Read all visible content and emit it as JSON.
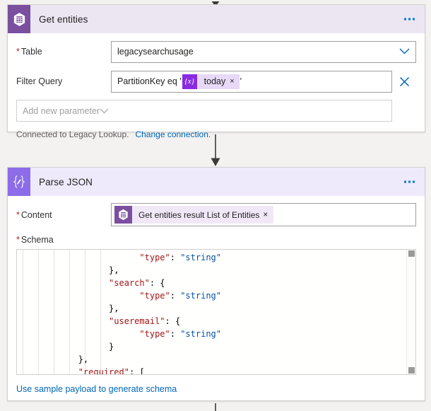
{
  "flow": {
    "connectors": [
      {
        "name": "connector-top",
        "type": "arrow-down-partial"
      },
      {
        "name": "connector-middle",
        "type": "arrow-down"
      },
      {
        "name": "connector-bottom",
        "type": "line-down"
      }
    ]
  },
  "get_entities": {
    "title": "Get entities",
    "icon": "azure-table-storage-icon",
    "more_label": "…",
    "table": {
      "label": "Table",
      "required": true,
      "value": "legacysearchusage",
      "chevron_icon": "chevron-down-icon"
    },
    "filter_query": {
      "label": "Filter Query",
      "required": false,
      "prefix": "PartitionKey eq '",
      "suffix": "'",
      "token": {
        "badge": "{x}",
        "label": "today",
        "remove_icon": "×"
      },
      "clear_icon": "close-icon"
    },
    "add_parameter": {
      "placeholder": "Add new parameter",
      "chevron_icon": "chevron-down-icon"
    },
    "connection_status": "Connected to Legacy Lookup.",
    "change_connection_link": "Change connection."
  },
  "parse_json": {
    "title": "Parse JSON",
    "icon": "parse-json-icon",
    "more_label": "…",
    "content": {
      "label": "Content",
      "required": true,
      "token": {
        "icon": "azure-table-storage-icon",
        "text": "Get entities result List of Entities",
        "remove_icon": "×"
      }
    },
    "schema": {
      "label": "Schema",
      "required": true,
      "lines": [
        {
          "indent": 24,
          "segments": [
            {
              "t": "\"type\"",
              "c": "k"
            },
            {
              "t": ": ",
              "c": "p"
            },
            {
              "t": "\"string\"",
              "c": "s"
            }
          ]
        },
        {
          "indent": 18,
          "segments": [
            {
              "t": "},",
              "c": "p"
            }
          ]
        },
        {
          "indent": 18,
          "segments": [
            {
              "t": "\"search\"",
              "c": "k"
            },
            {
              "t": ": {",
              "c": "p"
            }
          ]
        },
        {
          "indent": 24,
          "segments": [
            {
              "t": "\"type\"",
              "c": "k"
            },
            {
              "t": ": ",
              "c": "p"
            },
            {
              "t": "\"string\"",
              "c": "s"
            }
          ]
        },
        {
          "indent": 18,
          "segments": [
            {
              "t": "},",
              "c": "p"
            }
          ]
        },
        {
          "indent": 18,
          "segments": [
            {
              "t": "\"useremail\"",
              "c": "k"
            },
            {
              "t": ": {",
              "c": "p"
            }
          ]
        },
        {
          "indent": 24,
          "segments": [
            {
              "t": "\"type\"",
              "c": "k"
            },
            {
              "t": ": ",
              "c": "p"
            },
            {
              "t": "\"string\"",
              "c": "s"
            }
          ]
        },
        {
          "indent": 18,
          "segments": [
            {
              "t": "}",
              "c": "p"
            }
          ]
        },
        {
          "indent": 12,
          "segments": [
            {
              "t": "},",
              "c": "p"
            }
          ]
        },
        {
          "indent": 12,
          "segments": [
            {
              "t": "\"required\"",
              "c": "k"
            },
            {
              "t": ": [",
              "c": "p"
            }
          ]
        }
      ],
      "scrollbar": {
        "name": "schema-vertical-scrollbar"
      }
    },
    "generate_link": "Use sample payload to generate schema"
  },
  "colors": {
    "accent_purple_dark": "#7b4fa0",
    "accent_purple_light": "#8c6ce8",
    "header_get_entities": "#ece6f2",
    "header_parse_json": "#efeafb",
    "link_blue": "#0067b8",
    "required_red": "#a4262c",
    "canvas": "#f3f2f1",
    "token_bg": "#e7d9f7",
    "token_badge": "#8a2be2",
    "code_key": "#a31515",
    "code_string": "#0451a5"
  }
}
